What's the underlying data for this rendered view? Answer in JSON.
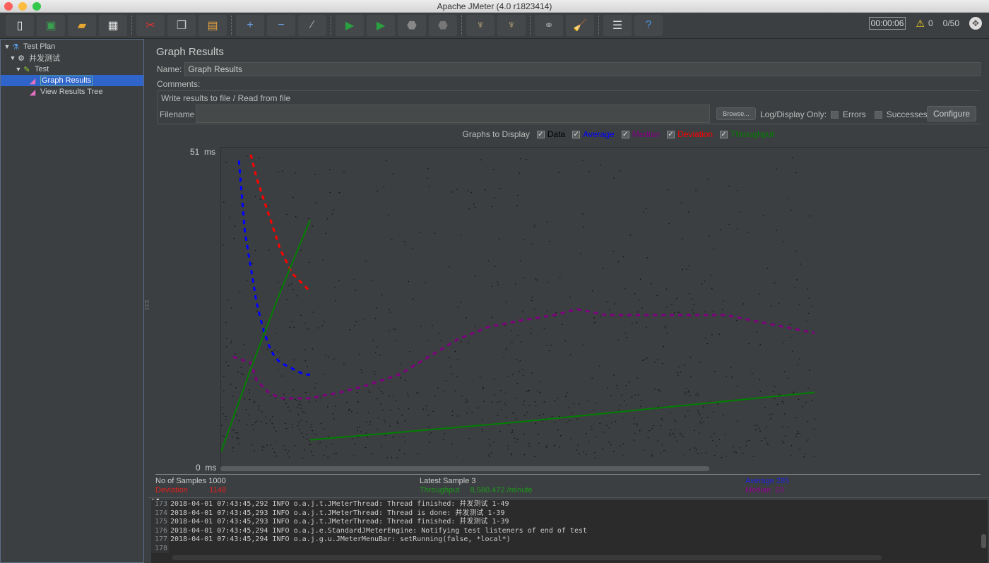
{
  "window": {
    "title": "Apache JMeter (4.0 r1823414)"
  },
  "toolbar": {
    "buttons": [
      {
        "name": "new-icon",
        "glyph": "▯",
        "color": "#eeeeee"
      },
      {
        "name": "templates-icon",
        "glyph": "▣",
        "color": "#3aa050"
      },
      {
        "name": "open-icon",
        "glyph": "▰",
        "color": "#e8a830"
      },
      {
        "name": "save-icon",
        "glyph": "▦",
        "color": "#dddddd"
      },
      {
        "sep": true
      },
      {
        "name": "cut-icon",
        "glyph": "✂",
        "color": "#e03030"
      },
      {
        "name": "copy-icon",
        "glyph": "❐",
        "color": "#cccccc"
      },
      {
        "name": "paste-icon",
        "glyph": "▤",
        "color": "#e0a040"
      },
      {
        "sep": true
      },
      {
        "name": "expand-icon",
        "glyph": "+",
        "color": "#6aa0e8"
      },
      {
        "name": "collapse-icon",
        "glyph": "−",
        "color": "#6aa0e8"
      },
      {
        "name": "toggle-icon",
        "glyph": "⁄",
        "color": "#aaaaaa"
      },
      {
        "sep": true
      },
      {
        "name": "start-icon",
        "glyph": "▶",
        "color": "#2aa040"
      },
      {
        "name": "start-no-pause-icon",
        "glyph": "▶",
        "color": "#2aa040"
      },
      {
        "name": "stop-icon",
        "glyph": "⬣",
        "color": "#888888"
      },
      {
        "name": "shutdown-icon",
        "glyph": "⬣",
        "color": "#777777"
      },
      {
        "sep": true
      },
      {
        "name": "clear-icon",
        "glyph": "♆",
        "color": "#c8b080"
      },
      {
        "name": "clear-all-icon",
        "glyph": "♆",
        "color": "#c8b080"
      },
      {
        "sep": true
      },
      {
        "name": "search-icon",
        "glyph": "⚭",
        "color": "#999999"
      },
      {
        "name": "reset-search-icon",
        "glyph": "🧹",
        "color": "#e8c020"
      },
      {
        "sep": true
      },
      {
        "name": "function-helper-icon",
        "glyph": "☰",
        "color": "#dddddd"
      },
      {
        "name": "help-icon",
        "glyph": "?",
        "color": "#4a90e0"
      }
    ],
    "timer": "00:00:06",
    "warning_count": "0",
    "threads": "0/50"
  },
  "tree": {
    "items": [
      {
        "label": "Test Plan",
        "level": 0,
        "toggle": "▼",
        "icon": "⚗",
        "icon_color": "#5aa0e8"
      },
      {
        "label": "并发测试",
        "level": 1,
        "toggle": "▼",
        "icon": "⚙",
        "icon_color": "#dddddd"
      },
      {
        "label": "Test",
        "level": 2,
        "toggle": "▼",
        "icon": "✎",
        "icon_color": "#9acd32"
      },
      {
        "label": "Graph Results",
        "level": 3,
        "toggle": "",
        "icon": "◢",
        "icon_color": "#e070c0",
        "selected": true
      },
      {
        "label": "View Results Tree",
        "level": 3,
        "toggle": "",
        "icon": "◢",
        "icon_color": "#e070c0"
      }
    ]
  },
  "panel": {
    "title": "Graph Results",
    "name_label": "Name:",
    "name_value": "Graph Results",
    "comments_label": "Comments:",
    "file_legend": "Write results to file / Read from file",
    "filename_label": "Filename",
    "filename_value": "",
    "browse_label": "Browse...",
    "log_display_label": "Log/Display Only:",
    "errors_label": "Errors",
    "successes_label": "Successes",
    "configure_label": "Configure",
    "graphs_to_display_label": "Graphs to Display",
    "graph_toggles": [
      {
        "label": "Data",
        "color": "#000000",
        "checked": true
      },
      {
        "label": "Average",
        "color": "#0000ff",
        "checked": true
      },
      {
        "label": "Median",
        "color": "#800080",
        "checked": true
      },
      {
        "label": "Deviation",
        "color": "#ff0000",
        "checked": true
      },
      {
        "label": "Throughput",
        "color": "#008000",
        "checked": true
      }
    ]
  },
  "chart_data": {
    "type": "line",
    "title": "",
    "ylabel": "ms",
    "ylim": [
      0,
      51
    ],
    "y_top_label": "51",
    "y_bottom_label": "0",
    "unit": "ms",
    "samples": 1000,
    "series": [
      {
        "name": "Average",
        "color": "#0000ff",
        "points": [
          [
            0.03,
            50
          ],
          [
            0.035,
            44
          ],
          [
            0.04,
            38
          ],
          [
            0.05,
            32
          ],
          [
            0.06,
            26
          ],
          [
            0.07,
            22
          ],
          [
            0.08,
            19
          ],
          [
            0.09,
            17
          ],
          [
            0.1,
            16
          ],
          [
            0.12,
            15
          ],
          [
            0.14,
            14
          ],
          [
            0.15,
            14
          ]
        ]
      },
      {
        "name": "Deviation",
        "color": "#ff0000",
        "points": [
          [
            0.05,
            51
          ],
          [
            0.06,
            47
          ],
          [
            0.07,
            44
          ],
          [
            0.08,
            41
          ],
          [
            0.09,
            38
          ],
          [
            0.1,
            35
          ],
          [
            0.11,
            33
          ],
          [
            0.12,
            31
          ],
          [
            0.13,
            30
          ],
          [
            0.14,
            29
          ],
          [
            0.15,
            28
          ]
        ]
      },
      {
        "name": "Median",
        "color": "#800080",
        "points": [
          [
            0.02,
            17
          ],
          [
            0.05,
            16
          ],
          [
            0.06,
            13
          ],
          [
            0.08,
            11
          ],
          [
            0.1,
            10
          ],
          [
            0.15,
            10
          ],
          [
            0.2,
            11
          ],
          [
            0.24,
            12
          ],
          [
            0.3,
            14
          ],
          [
            0.35,
            17
          ],
          [
            0.4,
            20
          ],
          [
            0.45,
            22
          ],
          [
            0.5,
            23
          ],
          [
            0.56,
            24
          ],
          [
            0.6,
            25
          ],
          [
            0.65,
            24
          ],
          [
            0.75,
            24
          ],
          [
            0.85,
            24
          ],
          [
            0.9,
            23
          ],
          [
            0.95,
            22
          ],
          [
            1.0,
            21
          ]
        ]
      },
      {
        "name": "Throughput",
        "color": "#008000",
        "points": [
          [
            0.0,
            1
          ],
          [
            0.05,
            15
          ],
          [
            0.1,
            28
          ],
          [
            0.15,
            40
          ]
        ],
        "second_segment": [
          [
            0.15,
            3
          ],
          [
            0.5,
            6
          ],
          [
            0.8,
            9
          ],
          [
            1.0,
            11
          ]
        ]
      }
    ]
  },
  "stats": {
    "samples_label": "No of Samples",
    "samples_value": "1000",
    "latest_label": "Latest Sample",
    "latest_value": "3",
    "average_label": "Average",
    "average_value": "285",
    "deviation_label": "Deviation",
    "deviation_value": "1148",
    "throughput_label": "Throughput",
    "throughput_value": "8,580.472 /minute",
    "median_label": "Median",
    "median_value": "23"
  },
  "log": {
    "lines": [
      {
        "n": "173",
        "text": "2018-04-01 07:43:45,292 INFO o.a.j.t.JMeterThread: Thread finished: 并发测试 1-49"
      },
      {
        "n": "174",
        "text": "2018-04-01 07:43:45,293 INFO o.a.j.t.JMeterThread: Thread is done: 并发测试 1-39"
      },
      {
        "n": "175",
        "text": "2018-04-01 07:43:45,293 INFO o.a.j.t.JMeterThread: Thread finished: 并发测试 1-39"
      },
      {
        "n": "176",
        "text": "2018-04-01 07:43:45,294 INFO o.a.j.e.StandardJMeterEngine: Notifying test listeners of end of test"
      },
      {
        "n": "177",
        "text": "2018-04-01 07:43:45,294 INFO o.a.j.g.u.JMeterMenuBar: setRunning(false, *local*)"
      },
      {
        "n": "178",
        "text": ""
      }
    ]
  }
}
